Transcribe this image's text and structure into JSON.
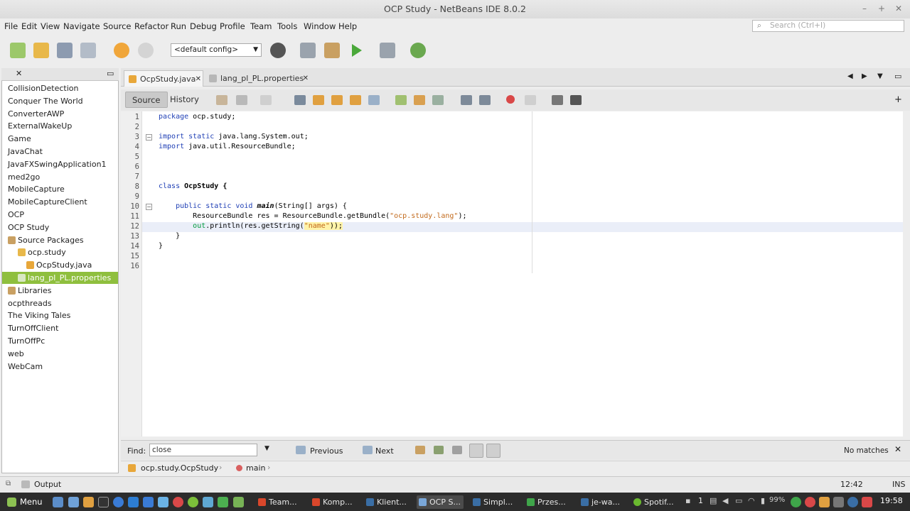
{
  "window": {
    "title": "OCP Study - NetBeans IDE 8.0.2"
  },
  "menubar": {
    "items": [
      "File",
      "Edit",
      "View",
      "Navigate",
      "Source",
      "Refactor",
      "Run",
      "Debug",
      "Profile",
      "Team",
      "Tools",
      "Window",
      "Help"
    ],
    "search_placeholder": "Search (Ctrl+I)"
  },
  "toolbar": {
    "config": "<default config>"
  },
  "projects": {
    "items": [
      {
        "label": "CollisionDetection",
        "level": 0
      },
      {
        "label": "Conquer The World",
        "level": 0
      },
      {
        "label": "ConverterAWP",
        "level": 0
      },
      {
        "label": "ExternalWakeUp",
        "level": 0
      },
      {
        "label": "Game",
        "level": 0
      },
      {
        "label": "JavaChat",
        "level": 0
      },
      {
        "label": "JavaFXSwingApplication1",
        "level": 0
      },
      {
        "label": "med2go",
        "level": 0
      },
      {
        "label": "MobileCapture",
        "level": 0
      },
      {
        "label": "MobileCaptureClient",
        "level": 0
      },
      {
        "label": "OCP",
        "level": 0
      },
      {
        "label": "OCP Study",
        "level": 0
      },
      {
        "label": "Source Packages",
        "level": 1
      },
      {
        "label": "ocp.study",
        "level": 2
      },
      {
        "label": "OcpStudy.java",
        "level": 3
      },
      {
        "label": "lang_pl_PL.properties",
        "level": 2,
        "selected": true
      },
      {
        "label": "Libraries",
        "level": 1
      },
      {
        "label": "ocpthreads",
        "level": 0
      },
      {
        "label": "The Viking Tales",
        "level": 0
      },
      {
        "label": "TurnOffClient",
        "level": 0
      },
      {
        "label": "TurnOffPc",
        "level": 0
      },
      {
        "label": "web",
        "level": 0
      },
      {
        "label": "WebCam",
        "level": 0
      }
    ]
  },
  "editor": {
    "tabs": [
      {
        "label": "OcpStudy.java",
        "active": true
      },
      {
        "label": "lang_pl_PL.properties",
        "active": false
      }
    ],
    "modes": {
      "source": "Source",
      "history": "History"
    },
    "line_numbers": [
      "1",
      "2",
      "3",
      "4",
      "5",
      "6",
      "7",
      "8",
      "9",
      "10",
      "11",
      "12",
      "13",
      "14",
      "15",
      "16"
    ],
    "code": {
      "l1": [
        "package",
        " ocp.study;"
      ],
      "l3": [
        "import static",
        " java.lang.System.out;"
      ],
      "l4": [
        "import",
        " java.util.ResourceBundle;"
      ],
      "l8": [
        "class",
        " OcpStudy {"
      ],
      "l10": [
        "    public static void",
        " main",
        "(String[] args) {"
      ],
      "l11": [
        "        ResourceBundle res = ResourceBundle.getBundle(",
        "\"ocp.study.lang\"",
        ");"
      ],
      "l12": [
        "        ",
        "out",
        ".println(res.getString(",
        "\"name\"",
        "));"
      ],
      "l13": [
        "    }"
      ],
      "l14": [
        "}"
      ]
    }
  },
  "findbar": {
    "label": "Find:",
    "value": "close",
    "previous": "Previous",
    "next": "Next",
    "status": "No matches"
  },
  "breadcrumb": {
    "class": "ocp.study.OcpStudy",
    "method": "main"
  },
  "statusbar": {
    "output": "Output",
    "position": "12:42",
    "mode": "INS"
  },
  "taskbar": {
    "menu": "Menu",
    "tasks": [
      {
        "label": "Team...",
        "color": "#d9472b"
      },
      {
        "label": "Komp...",
        "color": "#d9472b"
      },
      {
        "label": "Klient...",
        "color": "#3a6ea5"
      },
      {
        "label": "OCP S...",
        "color": "#7aa7d9",
        "active": true
      },
      {
        "label": "Simpl...",
        "color": "#3a6ea5"
      },
      {
        "label": "Przes...",
        "color": "#3fa54a"
      },
      {
        "label": "je-wa...",
        "color": "#3a6ea5"
      },
      {
        "label": "Spotif...",
        "color": "#6ab92f"
      }
    ],
    "tray_number": "1",
    "battery": "99%",
    "clock": "19:58"
  }
}
